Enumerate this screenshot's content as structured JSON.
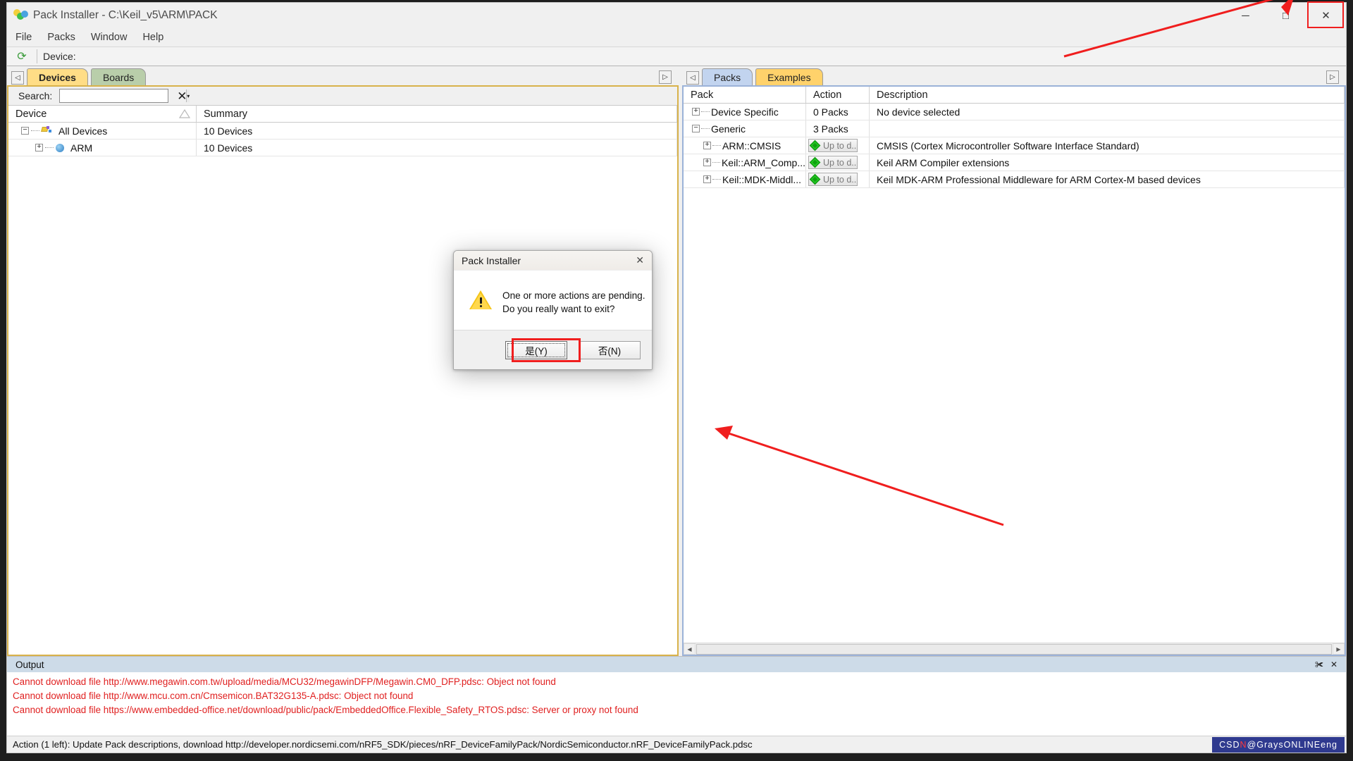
{
  "window": {
    "title": "Pack Installer - C:\\Keil_v5\\ARM\\PACK",
    "minimize": "─",
    "maximize": "□",
    "close": "✕"
  },
  "menu": {
    "items": [
      "File",
      "Packs",
      "Window",
      "Help"
    ]
  },
  "toolbar": {
    "refresh_icon": "⟳",
    "device_label": "Device:"
  },
  "left_pane": {
    "tabs": [
      {
        "label": "Devices",
        "active": true
      },
      {
        "label": "Boards",
        "active": false
      }
    ],
    "nav_left": "◁",
    "nav_right": "▷",
    "search": {
      "label": "Search:",
      "value": "",
      "placeholder": "",
      "clear_icon": "✕",
      "dropdown_icon": "▾"
    },
    "columns": [
      "Device",
      "Summary"
    ],
    "rows": [
      {
        "indent": 0,
        "twisty": "−",
        "icon": "devices-icon",
        "name": "All Devices",
        "summary": "10 Devices"
      },
      {
        "indent": 1,
        "twisty": "+",
        "icon": "arm-icon",
        "name": "ARM",
        "summary": "10 Devices"
      }
    ]
  },
  "right_pane": {
    "tabs": [
      {
        "label": "Packs",
        "active": true
      },
      {
        "label": "Examples",
        "active": false
      }
    ],
    "nav_left": "◁",
    "nav_right": "▷",
    "columns": [
      "Pack",
      "Action",
      "Description"
    ],
    "rows": [
      {
        "indent": 0,
        "twisty": "+",
        "pack": "Device Specific",
        "action": "0 Packs",
        "action_type": "text",
        "description": "No device selected"
      },
      {
        "indent": 0,
        "twisty": "−",
        "pack": "Generic",
        "action": "3 Packs",
        "action_type": "text",
        "description": ""
      },
      {
        "indent": 1,
        "twisty": "+",
        "pack": "ARM::CMSIS",
        "action": "Up to d..",
        "action_type": "button",
        "description": "CMSIS (Cortex Microcontroller Software Interface Standard)"
      },
      {
        "indent": 1,
        "twisty": "+",
        "pack": "Keil::ARM_Comp...",
        "action": "Up to d..",
        "action_type": "button",
        "description": "Keil ARM Compiler extensions"
      },
      {
        "indent": 1,
        "twisty": "+",
        "pack": "Keil::MDK-Middl...",
        "action": "Up to d..",
        "action_type": "button",
        "description": "Keil MDK-ARM Professional Middleware for ARM Cortex-M based devices"
      }
    ]
  },
  "output": {
    "title": "Output",
    "pin_icon": "✀",
    "close_icon": "✕",
    "lines": [
      "Cannot download file http://www.megawin.com.tw/upload/media/MCU32/megawinDFP/Megawin.CM0_DFP.pdsc: Object not found",
      "Cannot download file http://www.mcu.com.cn/Cmsemicon.BAT32G135-A.pdsc: Object not found",
      "Cannot download file https://www.embedded-office.net/download/public/pack/EmbeddedOffice.Flexible_Safety_RTOS.pdsc: Server or proxy not found"
    ]
  },
  "statusbar": {
    "text": "Action (1 left): Update Pack descriptions, download http://developer.nordicsemi.com/nRF5_SDK/pieces/nRF_DeviceFamilyPack/NordicSemiconductor.nRF_DeviceFamilyPack.pdsc",
    "watermark_prefix": "CSD",
    "watermark_mid": "N",
    "watermark_suffix": " @GraysONLINEeng"
  },
  "dialog": {
    "title": "Pack Installer",
    "close_icon": "✕",
    "warning_icon": "warning-icon",
    "message_line1": "One or more actions are pending.",
    "message_line2": "Do you really want to exit?",
    "buttons": [
      {
        "label": "是(Y)",
        "default": true
      },
      {
        "label": "否(N)",
        "default": false
      }
    ]
  },
  "colors": {
    "accent_yellow": "#ffdd86",
    "accent_green": "#b9ceaa",
    "accent_blue": "#c2d4ef",
    "error_red": "#e02020",
    "marker_red": "#f01e1e"
  }
}
